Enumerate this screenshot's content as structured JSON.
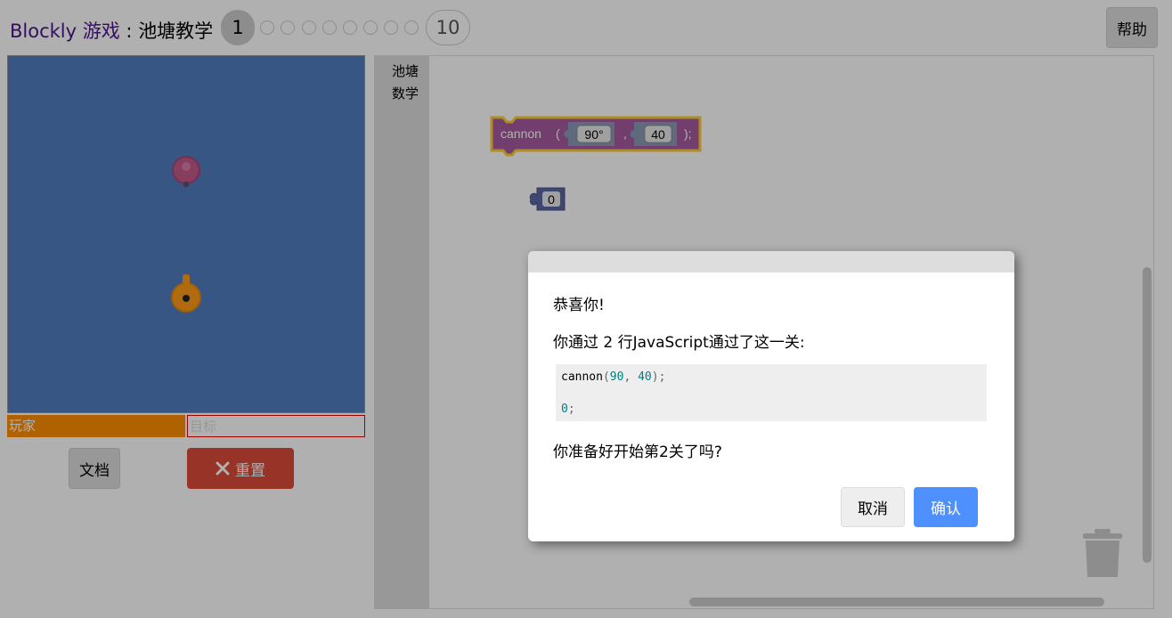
{
  "header": {
    "brand": "Blockly",
    "game": "游戏",
    "separator": " : ",
    "level_name": "池塘教学",
    "current_level": "1",
    "last_level": "10",
    "help_label": "帮助"
  },
  "visualization": {
    "player_label": "玩家",
    "target_label": "目标",
    "player_health": 1.0,
    "target_health": 0.0,
    "docs_label": "文档",
    "reset_label": "重置"
  },
  "toolbox": {
    "category": "池塘数学"
  },
  "workspace": {
    "cannon_block": {
      "name": "cannon",
      "open_paren": "(",
      "angle": "90°",
      "comma": ",",
      "range": "40",
      "close": ");"
    },
    "number_block": "0"
  },
  "dialog": {
    "congrats": "恭喜你!",
    "summary": "你通过 2 行JavaScript通过了这一关:",
    "code": {
      "line1_fn": "cannon",
      "line1_open": "(",
      "line1_arg1": "90",
      "line1_sep": ", ",
      "line1_arg2": "40",
      "line1_end": ");",
      "line2_num": "0",
      "line2_end": ";"
    },
    "next_prompt": "你准备好开始第2关了吗?",
    "cancel_label": "取消",
    "ok_label": "确认"
  },
  "colors": {
    "brand": "#4a148c",
    "pond_water": "#527dbf",
    "player_bar": "#ff8f00",
    "target_border": "#e60000",
    "reset_button": "#dd4b39",
    "ok_button": "#4d90fe",
    "block_purple": "#a55b9f",
    "block_highlight": "#fc3",
    "number_block": "#5b67a5"
  }
}
